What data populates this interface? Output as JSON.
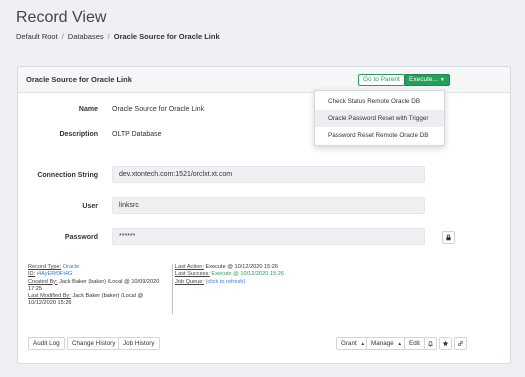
{
  "page": {
    "title": "Record View",
    "breadcrumb": [
      "Default Root",
      "Databases",
      "Oracle Source for Oracle Link"
    ]
  },
  "panel": {
    "title": "Oracle Source for Oracle Link",
    "go_to_parent_label": "Go to Parent",
    "execute_label": "Execute..."
  },
  "execute_menu": {
    "items": [
      "Check Status Remote Oracle DB",
      "Oracle Password Reset with Trigger",
      "Password Reset Remote Oracle DB"
    ]
  },
  "fields": {
    "name_label": "Name",
    "name_value": "Oracle Source for Oracle Link",
    "description_label": "Description",
    "description_value": "OLTP Database",
    "connection_label": "Connection String",
    "connection_value": "dev.xtontech.com:1521/orclxt.xt.com",
    "user_label": "User",
    "user_value": "linksrc",
    "password_label": "Password",
    "password_value": "******"
  },
  "meta": {
    "record_type_label": "Record Type:",
    "record_type_value": "Oracle",
    "id_label": "ID:",
    "id_value": "i4AyERf9Ft4G",
    "created_by_label": "Created By:",
    "created_by_value": "Jack Baker (baker) /Local @ 10/09/2020",
    "created_by_value_2": "17:25",
    "modified_by_label": "Last Modified By:",
    "modified_by_value": "Jack Baker (baker) /Local @",
    "modified_by_value_2": "10/12/2020 15:26",
    "last_action_label": "Last Action:",
    "last_action_value": "Execute @ 10/12/2020 15:26",
    "last_success_label": "Last Success:",
    "last_success_value": "Execute @ 10/12/2020 15:26",
    "job_queue_label": "Job Queue:",
    "job_queue_value": "(click to refresh)"
  },
  "footer": {
    "audit_log": "Audit Log",
    "change_history": "Change History",
    "job_history": "Job History",
    "grant": "Grant",
    "manage": "Manage",
    "edit": "Edit"
  },
  "colors": {
    "accent_green": "#24a05a",
    "link_blue": "#3a7bd5"
  },
  "icons": [
    "lock-icon",
    "bell-icon",
    "star-icon",
    "link-icon",
    "caret-down-icon"
  ]
}
